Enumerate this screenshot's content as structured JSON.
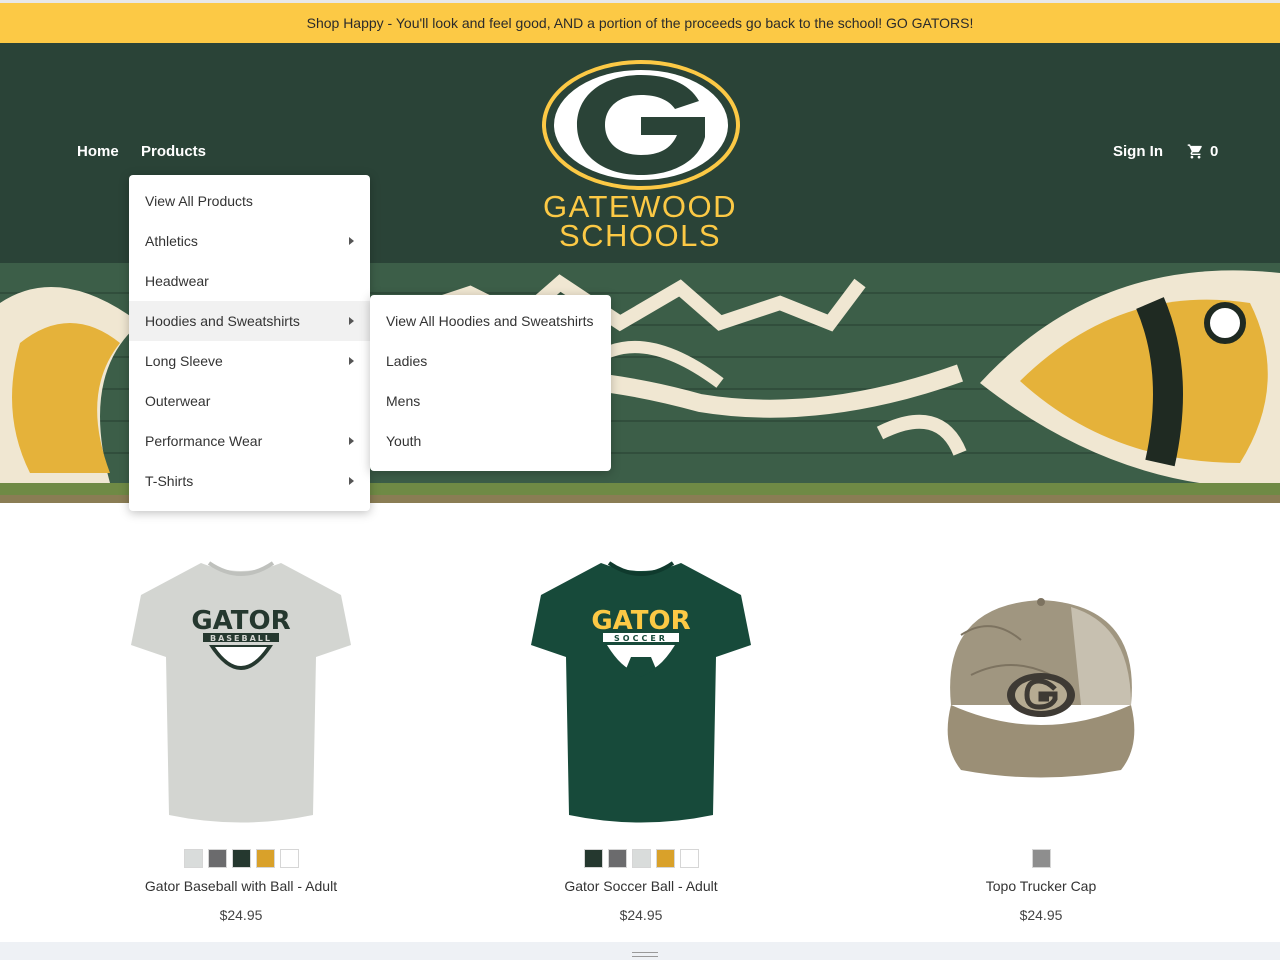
{
  "promo": {
    "text": "Shop Happy - You'll look and feel good, AND a portion of the proceeds go back to the school! GO GATORS!"
  },
  "nav": {
    "home": "Home",
    "products": "Products",
    "sign_in": "Sign In",
    "cart_count": "0"
  },
  "logo": {
    "line1": "GATEWOOD",
    "line2": "SCHOOLS"
  },
  "products_menu": [
    {
      "label": "View All Products"
    },
    {
      "label": "Athletics"
    },
    {
      "label": "Headwear"
    },
    {
      "label": "Hoodies and Sweatshirts"
    },
    {
      "label": "Long Sleeve"
    },
    {
      "label": "Outerwear"
    },
    {
      "label": "Performance Wear"
    },
    {
      "label": "T-Shirts"
    }
  ],
  "submenu": [
    {
      "label": "View All Hoodies and Sweatshirts"
    },
    {
      "label": "Ladies"
    },
    {
      "label": "Mens"
    },
    {
      "label": "Youth"
    }
  ],
  "products": [
    {
      "name": "Gator Baseball with Ball - Adult",
      "price": "$24.95",
      "shirt_text": "GATOR",
      "sub_text": "BASEBALL",
      "swatches": [
        "#d9dcdb",
        "#6b6b6d",
        "#25382f",
        "#d9a12a",
        "#ffffff"
      ]
    },
    {
      "name": "Gator Soccer Ball - Adult",
      "price": "$24.95",
      "shirt_text": "GATOR",
      "sub_text": "SOCCER",
      "swatches": [
        "#25382f",
        "#6b6b6d",
        "#d9dcdb",
        "#d9a12a",
        "#ffffff"
      ]
    },
    {
      "name": "Topo Trucker Cap",
      "price": "$24.95",
      "swatches": [
        "#8e8e8e"
      ]
    }
  ],
  "colors": {
    "promo": "#fcc945",
    "header": "#2a4337",
    "accent": "#fcc945"
  }
}
